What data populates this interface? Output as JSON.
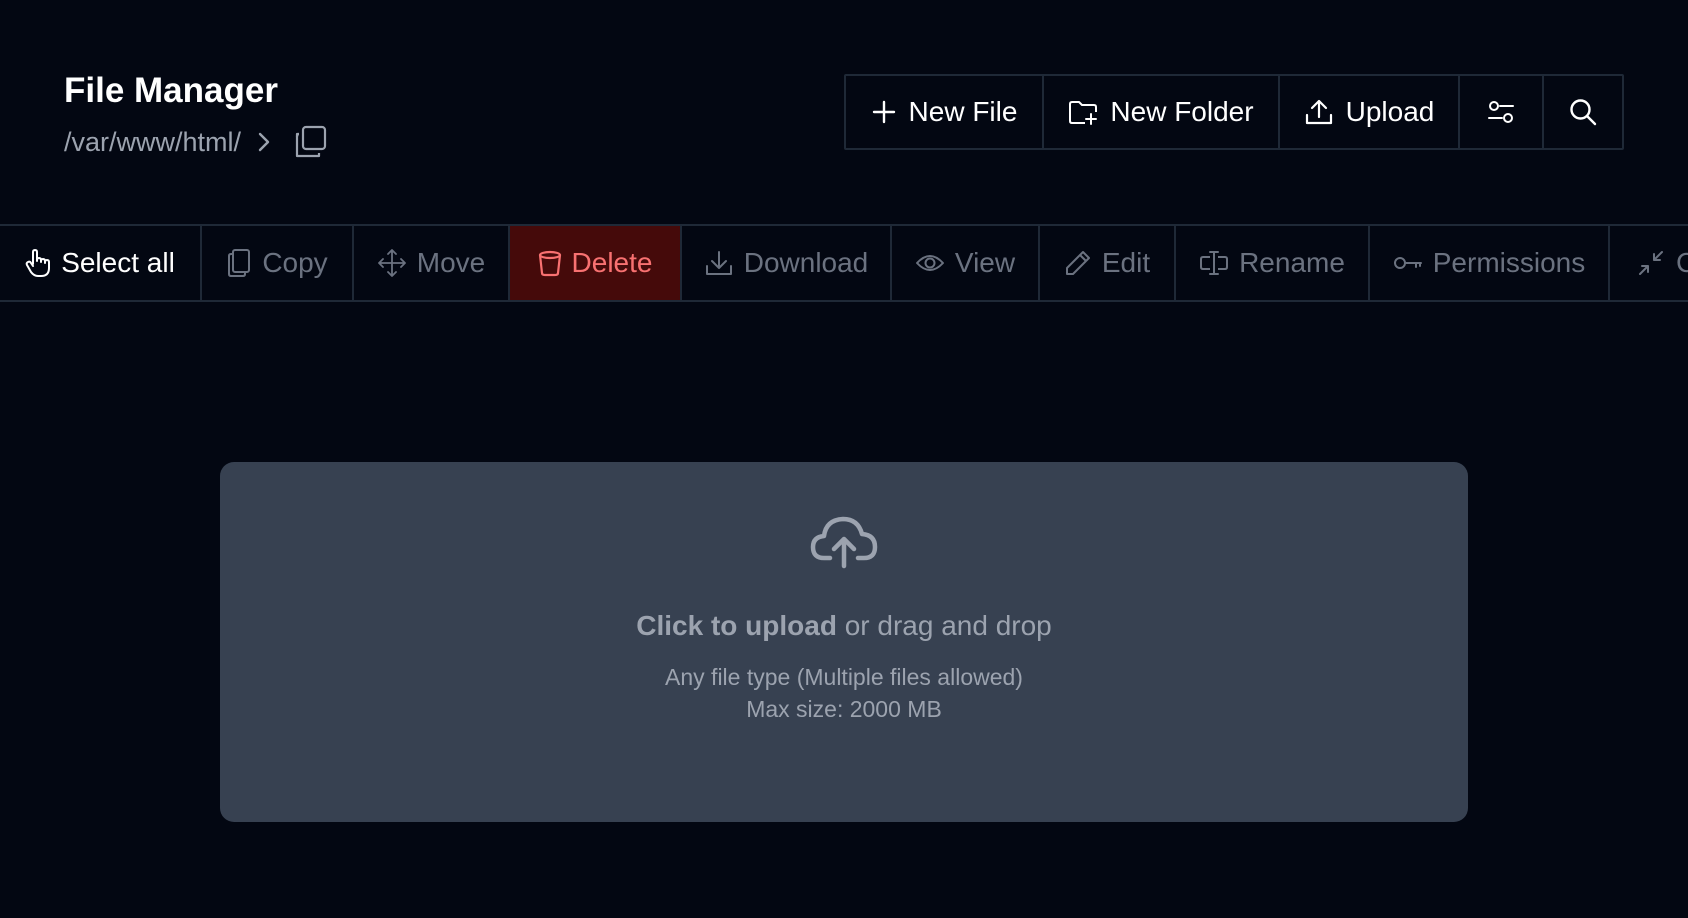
{
  "header": {
    "title": "File Manager",
    "path": "/var/www/html/"
  },
  "top_actions": {
    "new_file": "New File",
    "new_folder": "New Folder",
    "upload": "Upload"
  },
  "toolbar": {
    "select_all": "Select all",
    "copy": "Copy",
    "move": "Move",
    "delete": "Delete",
    "download": "Download",
    "view": "View",
    "edit": "Edit",
    "rename": "Rename",
    "permissions": "Permissions",
    "compress_partial": "C"
  },
  "dropzone": {
    "click_text": "Click to upload",
    "drag_text": " or drag and drop",
    "types": "Any file type (Multiple files allowed)",
    "max_size": "Max size: 2000 MB"
  },
  "icons": {
    "copy_path": "copy-icon",
    "new_file": "plus-icon",
    "new_folder": "folder-plus-icon",
    "upload": "upload-icon",
    "filter": "sliders-icon",
    "search": "search-icon",
    "select_all": "pointer-hand-icon",
    "delete": "trash-icon",
    "dropzone": "cloud-upload-icon"
  },
  "colors": {
    "background": "#030712",
    "border": "#1f2937",
    "muted_text": "#9ca3af",
    "disabled_text": "#6b7280",
    "delete_bg": "#450a0a",
    "delete_text": "#f87171",
    "dropzone_bg": "#374151"
  }
}
